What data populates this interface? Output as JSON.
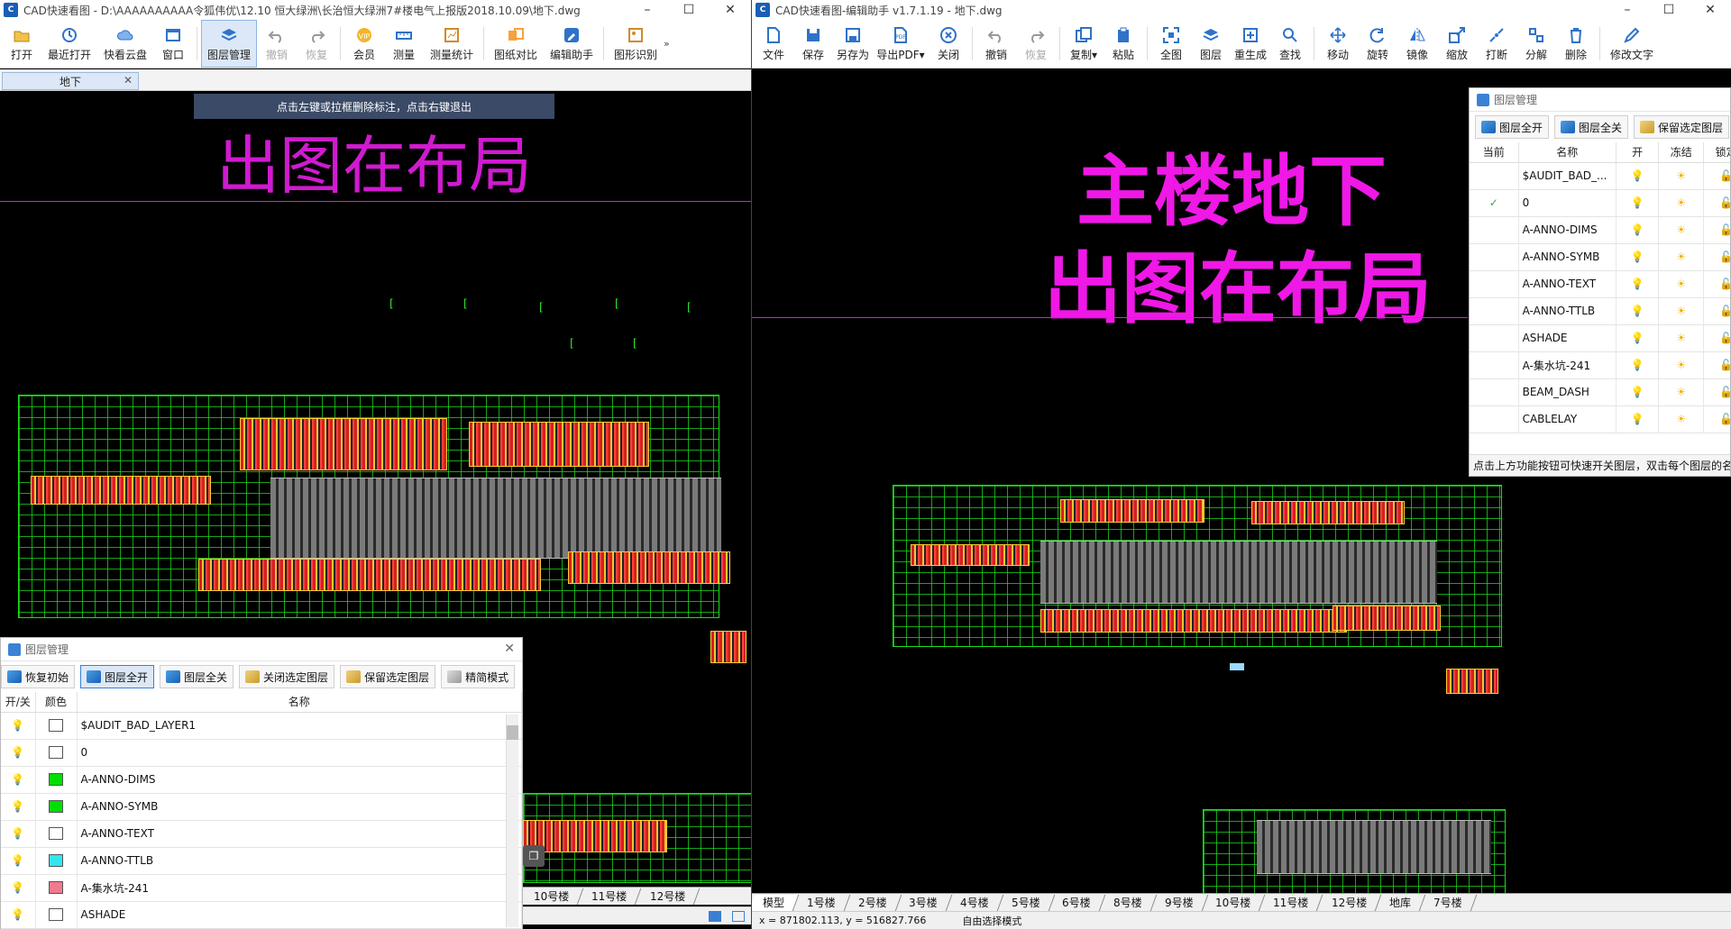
{
  "left": {
    "title": "CAD快速看图 - D:\\AAAAAAAAAA令狐伟优\\12.10 恒大绿洲\\长治恒大绿洲7#楼电气上报版2018.10.09\\地下.dwg",
    "toolbar": [
      {
        "label": "打开",
        "icon": "folder-open-icon"
      },
      {
        "label": "最近打开",
        "icon": "history-icon"
      },
      {
        "label": "快看云盘",
        "icon": "cloud-icon"
      },
      {
        "label": "窗口",
        "icon": "window-icon"
      },
      {
        "label": "图层管理",
        "icon": "layers-icon",
        "active": true
      },
      {
        "label": "撤销",
        "icon": "undo-icon",
        "disabled": true
      },
      {
        "label": "恢复",
        "icon": "redo-icon",
        "disabled": true
      },
      {
        "label": "会员",
        "icon": "vip-icon"
      },
      {
        "label": "测量",
        "icon": "ruler-icon"
      },
      {
        "label": "测量统计",
        "icon": "measure-stats-icon"
      },
      {
        "label": "图纸对比",
        "icon": "compare-icon"
      },
      {
        "label": "编辑助手",
        "icon": "edit-assistant-icon"
      },
      {
        "label": "图形识别",
        "icon": "shape-recognition-icon"
      }
    ],
    "more": "»",
    "doc_tab": "地下",
    "hint": "点击左键或拉框删除标注，点击右键退出",
    "cad_title": "出图在布局",
    "layer_panel": {
      "title": "图层管理",
      "buttons": [
        "恢复初始",
        "图层全开",
        "图层全关",
        "关闭选定图层",
        "保留选定图层",
        "精简模式"
      ],
      "headers": {
        "onoff": "开/关",
        "color": "颜色",
        "name": "名称"
      },
      "rows": [
        {
          "name": "$AUDIT_BAD_LAYER1",
          "color": "#ffffff"
        },
        {
          "name": "0",
          "color": "#ffffff"
        },
        {
          "name": "A-ANNO-DIMS",
          "color": "#00e000"
        },
        {
          "name": "A-ANNO-SYMB",
          "color": "#00e000"
        },
        {
          "name": "A-ANNO-TEXT",
          "color": "#ffffff"
        },
        {
          "name": "A-ANNO-TTLB",
          "color": "#33e6ee"
        },
        {
          "name": "A-集水坑-241",
          "color": "#f07a8e"
        },
        {
          "name": "ASHADE",
          "color": "#ffffff"
        }
      ]
    },
    "sheet_tabs": [
      "10号楼",
      "11号楼",
      "12号楼"
    ]
  },
  "right": {
    "title": "CAD快速看图-编辑助手 v1.7.1.19 - 地下.dwg",
    "toolbar": [
      {
        "label": "文件",
        "icon": "file-icon"
      },
      {
        "label": "保存",
        "icon": "save-icon"
      },
      {
        "label": "另存为",
        "icon": "save-as-icon"
      },
      {
        "label": "导出PDF▾",
        "icon": "export-pdf-icon"
      },
      {
        "label": "关闭",
        "icon": "close-circle-icon"
      },
      {
        "label": "撤销",
        "icon": "undo-icon"
      },
      {
        "label": "恢复",
        "icon": "redo-icon",
        "disabled": true
      },
      {
        "label": "复制▾",
        "icon": "copy-icon"
      },
      {
        "label": "粘贴",
        "icon": "paste-icon"
      },
      {
        "label": "全图",
        "icon": "fit-all-icon"
      },
      {
        "label": "图层",
        "icon": "layers-icon"
      },
      {
        "label": "重生成",
        "icon": "regen-icon"
      },
      {
        "label": "查找",
        "icon": "find-icon"
      },
      {
        "label": "移动",
        "icon": "move-icon"
      },
      {
        "label": "旋转",
        "icon": "rotate-icon"
      },
      {
        "label": "镜像",
        "icon": "mirror-icon"
      },
      {
        "label": "缩放",
        "icon": "scale-icon"
      },
      {
        "label": "打断",
        "icon": "break-icon"
      },
      {
        "label": "分解",
        "icon": "explode-icon"
      },
      {
        "label": "删除",
        "icon": "delete-icon"
      },
      {
        "label": "修改文字",
        "icon": "edit-text-icon"
      }
    ],
    "cad_title_1": "主楼地下",
    "cad_title_2": "出图在布局",
    "layer_panel": {
      "title": "图层管理",
      "buttons": [
        "图层全开",
        "图层全关",
        "保留选定图层"
      ],
      "headers": {
        "current": "当前",
        "name": "名称",
        "on": "开",
        "freeze": "冻结",
        "lock": "锁定"
      },
      "rows": [
        {
          "name": "$AUDIT_BAD_...",
          "current": false
        },
        {
          "name": "0",
          "current": true
        },
        {
          "name": "A-ANNO-DIMS",
          "current": false
        },
        {
          "name": "A-ANNO-SYMB",
          "current": false
        },
        {
          "name": "A-ANNO-TEXT",
          "current": false
        },
        {
          "name": "A-ANNO-TTLB",
          "current": false
        },
        {
          "name": "ASHADE",
          "current": false
        },
        {
          "name": "A-集水坑-241",
          "current": false
        },
        {
          "name": "BEAM_DASH",
          "current": false
        },
        {
          "name": "CABLELAY",
          "current": false
        }
      ],
      "footer": "点击上方功能按钮可快速开关图层，双击每个图层的名"
    },
    "sheet_tabs": [
      "模型",
      "1号楼",
      "2号楼",
      "3号楼",
      "4号楼",
      "5号楼",
      "6号楼",
      "8号楼",
      "9号楼",
      "10号楼",
      "11号楼",
      "12号楼",
      "地库",
      "7号楼"
    ],
    "status": {
      "coords": "x = 871802.113,  y = 516827.766",
      "mode": "自由选择模式"
    }
  }
}
